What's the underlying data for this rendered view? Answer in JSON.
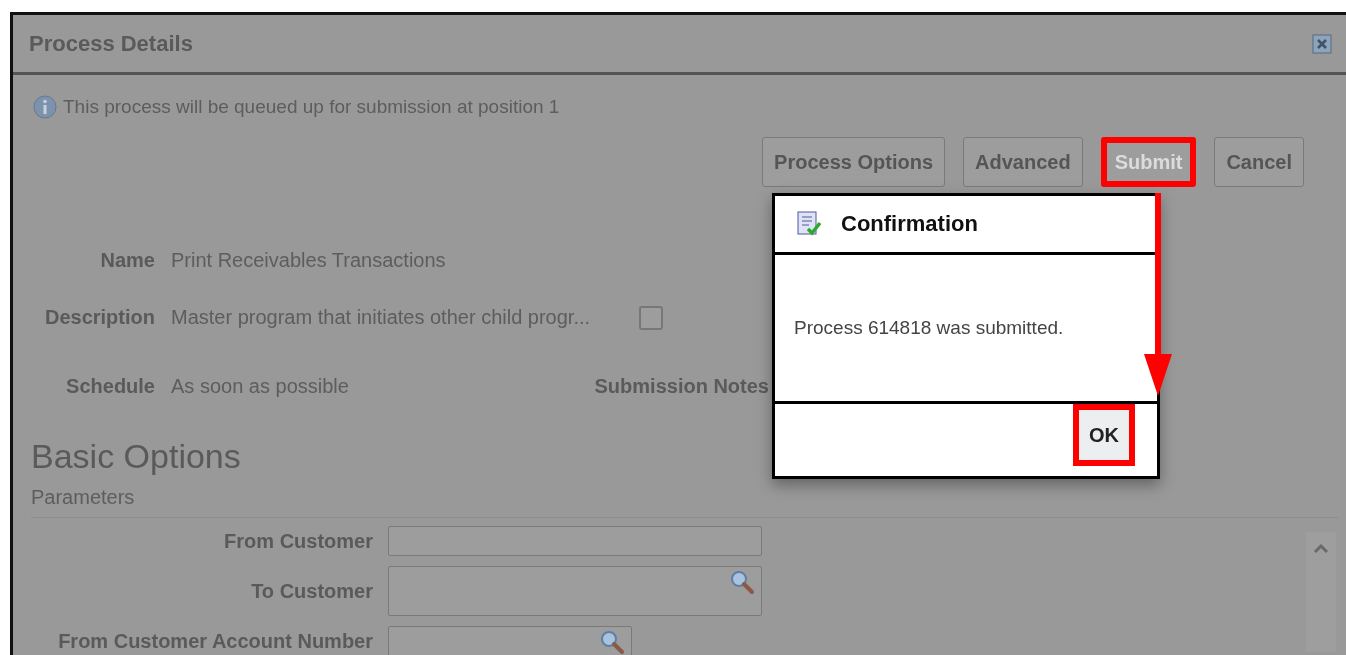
{
  "window": {
    "title": "Process Details"
  },
  "info_message": "This process will be queued up for submission at position 1",
  "buttons": [
    {
      "label": "Process Options",
      "disabled": false,
      "highlighted": false
    },
    {
      "label": "Advanced",
      "disabled": false,
      "highlighted": false
    },
    {
      "label": "Submit",
      "disabled": true,
      "highlighted": true
    },
    {
      "label": "Cancel",
      "disabled": false,
      "highlighted": false
    }
  ],
  "details": [
    {
      "label": "Name",
      "value": "Print Receivables Transactions"
    },
    {
      "label": "Description",
      "value": "Master program that initiates other child progr..."
    },
    {
      "label": "Schedule",
      "value": "As soon as possible"
    }
  ],
  "notify_checkbox": {
    "checked": false
  },
  "submission_notes": {
    "label": "Submission Notes"
  },
  "section": {
    "title": "Basic Options",
    "subtitle": "Parameters"
  },
  "parameters": [
    {
      "label": "From Customer",
      "kind": "text",
      "narrow": false
    },
    {
      "label": "To Customer",
      "kind": "lookup",
      "narrow": false
    },
    {
      "label": "From Customer Account Number",
      "kind": "lookup",
      "narrow": true
    }
  ],
  "confirmation": {
    "title": "Confirmation",
    "message": "Process 614818 was submitted.",
    "ok_button": {
      "label": "OK",
      "highlighted": true
    }
  },
  "annotation_arrow": true
}
